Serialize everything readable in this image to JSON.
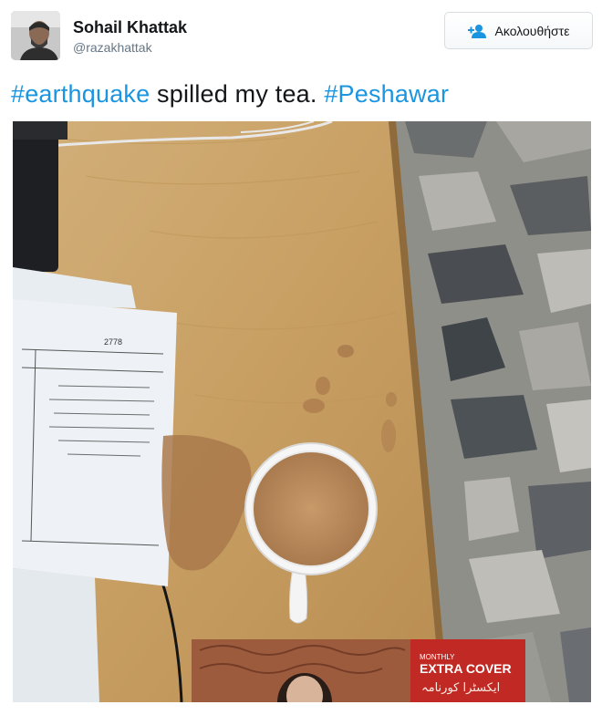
{
  "user": {
    "name": "Sohail Khattak",
    "handle": "@razakhattak"
  },
  "follow_button": {
    "label": "Ακολουθήστε",
    "icon": "add-user-icon"
  },
  "tweet": {
    "hashtag1": "#earthquake",
    "text_middle": " spilled my tea. ",
    "hashtag2": "#Peshawar"
  },
  "photo": {
    "document_number": "2778",
    "magazine": {
      "label_top": "MONTHLY",
      "title": "EXTRA COVER",
      "urdu_title": "ایکسٹرا کورنامہ"
    }
  },
  "colors": {
    "hashtag": "#1b95e0",
    "text": "#14171a",
    "secondary": "#657786",
    "table": "#c9a56c",
    "tea": "#b98b5e"
  }
}
